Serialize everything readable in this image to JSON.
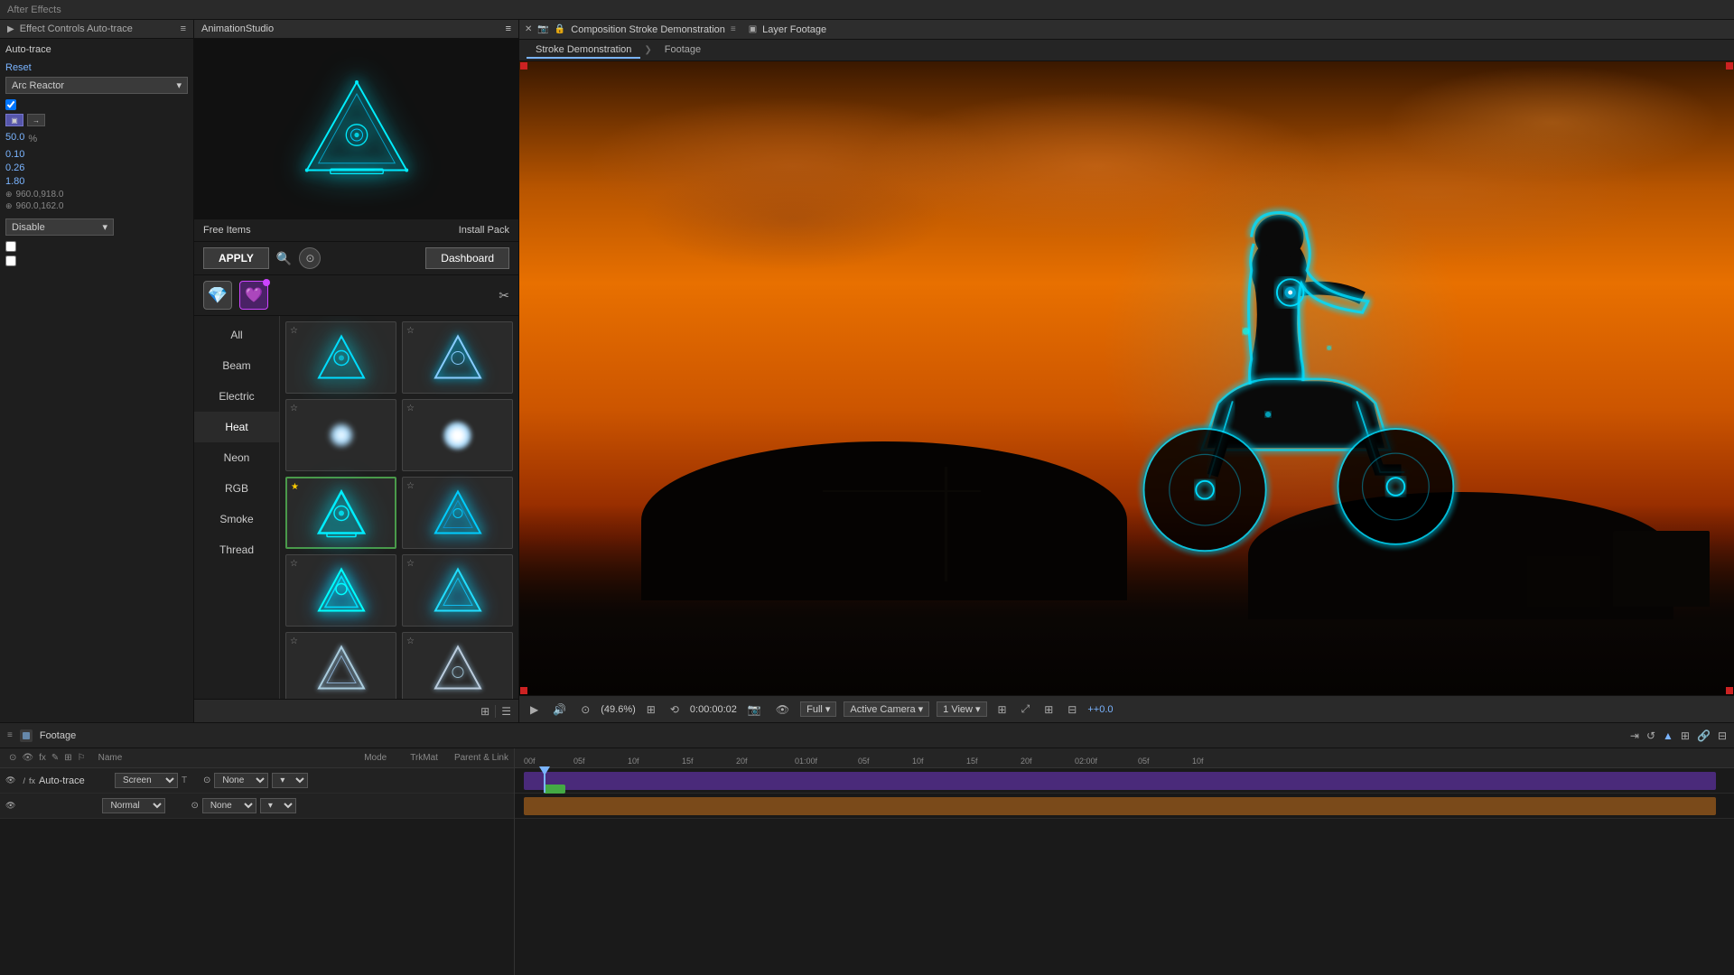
{
  "app": {
    "title": "After Effects",
    "left_panel_title": "Effect Controls Auto-trace",
    "anim_panel_title": "AnimationStudio"
  },
  "effect_controls": {
    "layer_name": "Auto-trace",
    "reset_label": "Reset",
    "preset_label": "Arc Reactor",
    "percentage": "50.0",
    "pct_unit": "%",
    "values": [
      "0.10",
      "0.26",
      "1.80"
    ],
    "coords1": "960.0,918.0",
    "coords2": "960.0,162.0",
    "disable_label": "Disable"
  },
  "anim_studio": {
    "title": "AnimationStudio",
    "free_items": "Free Items",
    "install_pack": "Install Pack",
    "apply_btn": "APPLY",
    "dashboard_btn": "Dashboard",
    "categories": [
      "All",
      "Beam",
      "Electric",
      "Heat",
      "Neon",
      "RGB",
      "Smoke",
      "Thread"
    ],
    "active_category": "Heat"
  },
  "composition": {
    "title": "Composition Stroke Demonstration",
    "tab1": "Stroke Demonstration",
    "tab2": "Footage",
    "layer_footage": "Layer Footage",
    "zoom": "49.6%",
    "time": "0:00:00:02",
    "quality": "Full",
    "camera": "Active Camera",
    "view": "1 View",
    "offset": "+0.0"
  },
  "timeline": {
    "footage_label": "Footage",
    "layer_name": "Auto-trace",
    "mode_screen": "Screen",
    "mode_normal": "Normal",
    "trkmat_t": "T",
    "parent_none": "None",
    "time_markers": [
      "00f",
      "05f",
      "10f",
      "15f",
      "20f",
      "01:00f",
      "05f",
      "10f",
      "15f",
      "20f",
      "02:00f",
      "05f",
      "10f"
    ],
    "columns": {
      "name": "Name",
      "mode": "Mode",
      "trkmat": "TrkMat",
      "parent": "Parent & Link"
    }
  },
  "icons": {
    "menu": "≡",
    "close": "✕",
    "search": "🔍",
    "settings": "⚙",
    "wrench": "🔧",
    "star_empty": "☆",
    "star_full": "★",
    "camera": "📷",
    "eye": "👁",
    "lock": "🔒",
    "chevron_down": "▾",
    "chevron_right": "❯",
    "play": "▶",
    "stop": "■",
    "grid": "⊞",
    "list": "☰"
  }
}
